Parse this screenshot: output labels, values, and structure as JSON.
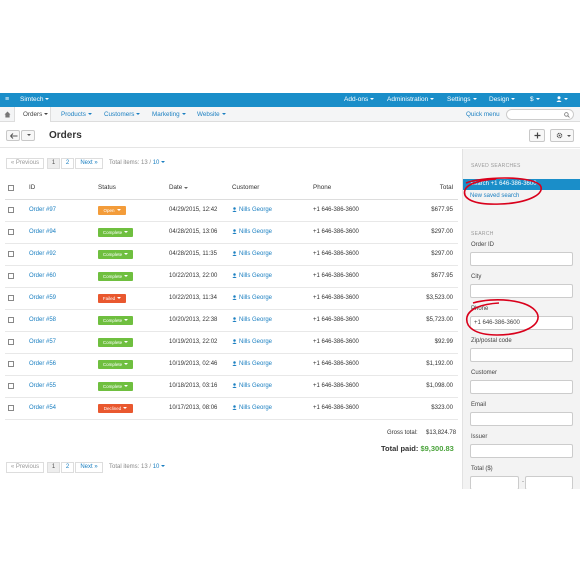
{
  "topbar": {
    "company": "Simtech",
    "nav": [
      "Add-ons",
      "Administration",
      "Settings",
      "Design",
      "$"
    ]
  },
  "subnav": {
    "items": [
      "Orders",
      "Products",
      "Customers",
      "Marketing",
      "Website"
    ],
    "quick_menu": "Quick menu",
    "search_placeholder": ""
  },
  "page": {
    "title": "Orders"
  },
  "pager": {
    "prev": "« Previous",
    "pages": [
      "1",
      "2"
    ],
    "next": "Next »",
    "total_label": "Total items:",
    "total_value": "13",
    "per_page": "10"
  },
  "table": {
    "headers": {
      "id": "ID",
      "status": "Status",
      "date": "Date",
      "customer": "Customer",
      "phone": "Phone",
      "total": "Total"
    },
    "rows": [
      {
        "id": "Order #97",
        "status": "Open",
        "status_type": "open",
        "date": "04/29/2015, 12:42",
        "customer": "Nills George",
        "phone": "+1 646-386-3600",
        "total": "$677.95"
      },
      {
        "id": "Order #94",
        "status": "Complete",
        "status_type": "complete",
        "date": "04/28/2015, 13:06",
        "customer": "Nills George",
        "phone": "+1 646-386-3600",
        "total": "$297.00"
      },
      {
        "id": "Order #92",
        "status": "Complete",
        "status_type": "complete",
        "date": "04/28/2015, 11:35",
        "customer": "Nills George",
        "phone": "+1 646-386-3600",
        "total": "$297.00"
      },
      {
        "id": "Order #60",
        "status": "Complete",
        "status_type": "complete",
        "date": "10/22/2013, 22:00",
        "customer": "Nills George",
        "phone": "+1 646-386-3600",
        "total": "$677.95"
      },
      {
        "id": "Order #59",
        "status": "Failed",
        "status_type": "failed",
        "date": "10/22/2013, 11:34",
        "customer": "Nills George",
        "phone": "+1 646-386-3600",
        "total": "$3,523.00"
      },
      {
        "id": "Order #58",
        "status": "Complete",
        "status_type": "complete",
        "date": "10/20/2013, 22:38",
        "customer": "Nills George",
        "phone": "+1 646-386-3600",
        "total": "$5,723.00"
      },
      {
        "id": "Order #57",
        "status": "Complete",
        "status_type": "complete",
        "date": "10/19/2013, 22:02",
        "customer": "Nills George",
        "phone": "+1 646-386-3600",
        "total": "$92.99"
      },
      {
        "id": "Order #56",
        "status": "Complete",
        "status_type": "complete",
        "date": "10/19/2013, 02:46",
        "customer": "Nills George",
        "phone": "+1 646-386-3600",
        "total": "$1,192.00"
      },
      {
        "id": "Order #55",
        "status": "Complete",
        "status_type": "complete",
        "date": "10/18/2013, 03:16",
        "customer": "Nills George",
        "phone": "+1 646-386-3600",
        "total": "$1,098.00"
      },
      {
        "id": "Order #54",
        "status": "Declined",
        "status_type": "declined",
        "date": "10/17/2013, 08:06",
        "customer": "Nills George",
        "phone": "+1 646-386-3600",
        "total": "$323.00"
      }
    ]
  },
  "totals": {
    "gross_label": "Gross total:",
    "gross_value": "$13,824.78",
    "paid_label": "Total paid:",
    "paid_value": "$9,300.83"
  },
  "sidebar": {
    "saved_heading": "SAVED SEARCHES",
    "saved_selected": "Search +1 646-386-3600",
    "saved_link": "New saved search",
    "search_heading": "SEARCH",
    "fields": [
      {
        "label": "Order ID",
        "value": ""
      },
      {
        "label": "City",
        "value": ""
      },
      {
        "label": "Phone",
        "value": "+1 646-386-3600"
      },
      {
        "label": "Zip/postal code",
        "value": ""
      },
      {
        "label": "Customer",
        "value": ""
      },
      {
        "label": "Email",
        "value": ""
      },
      {
        "label": "Issuer",
        "value": ""
      }
    ],
    "total_label": "Total ($)"
  },
  "colors": {
    "topbar": "#1a8ec9",
    "link": "#1a7fc1",
    "paid": "#4aa33b",
    "annotation": "#d9001b"
  }
}
